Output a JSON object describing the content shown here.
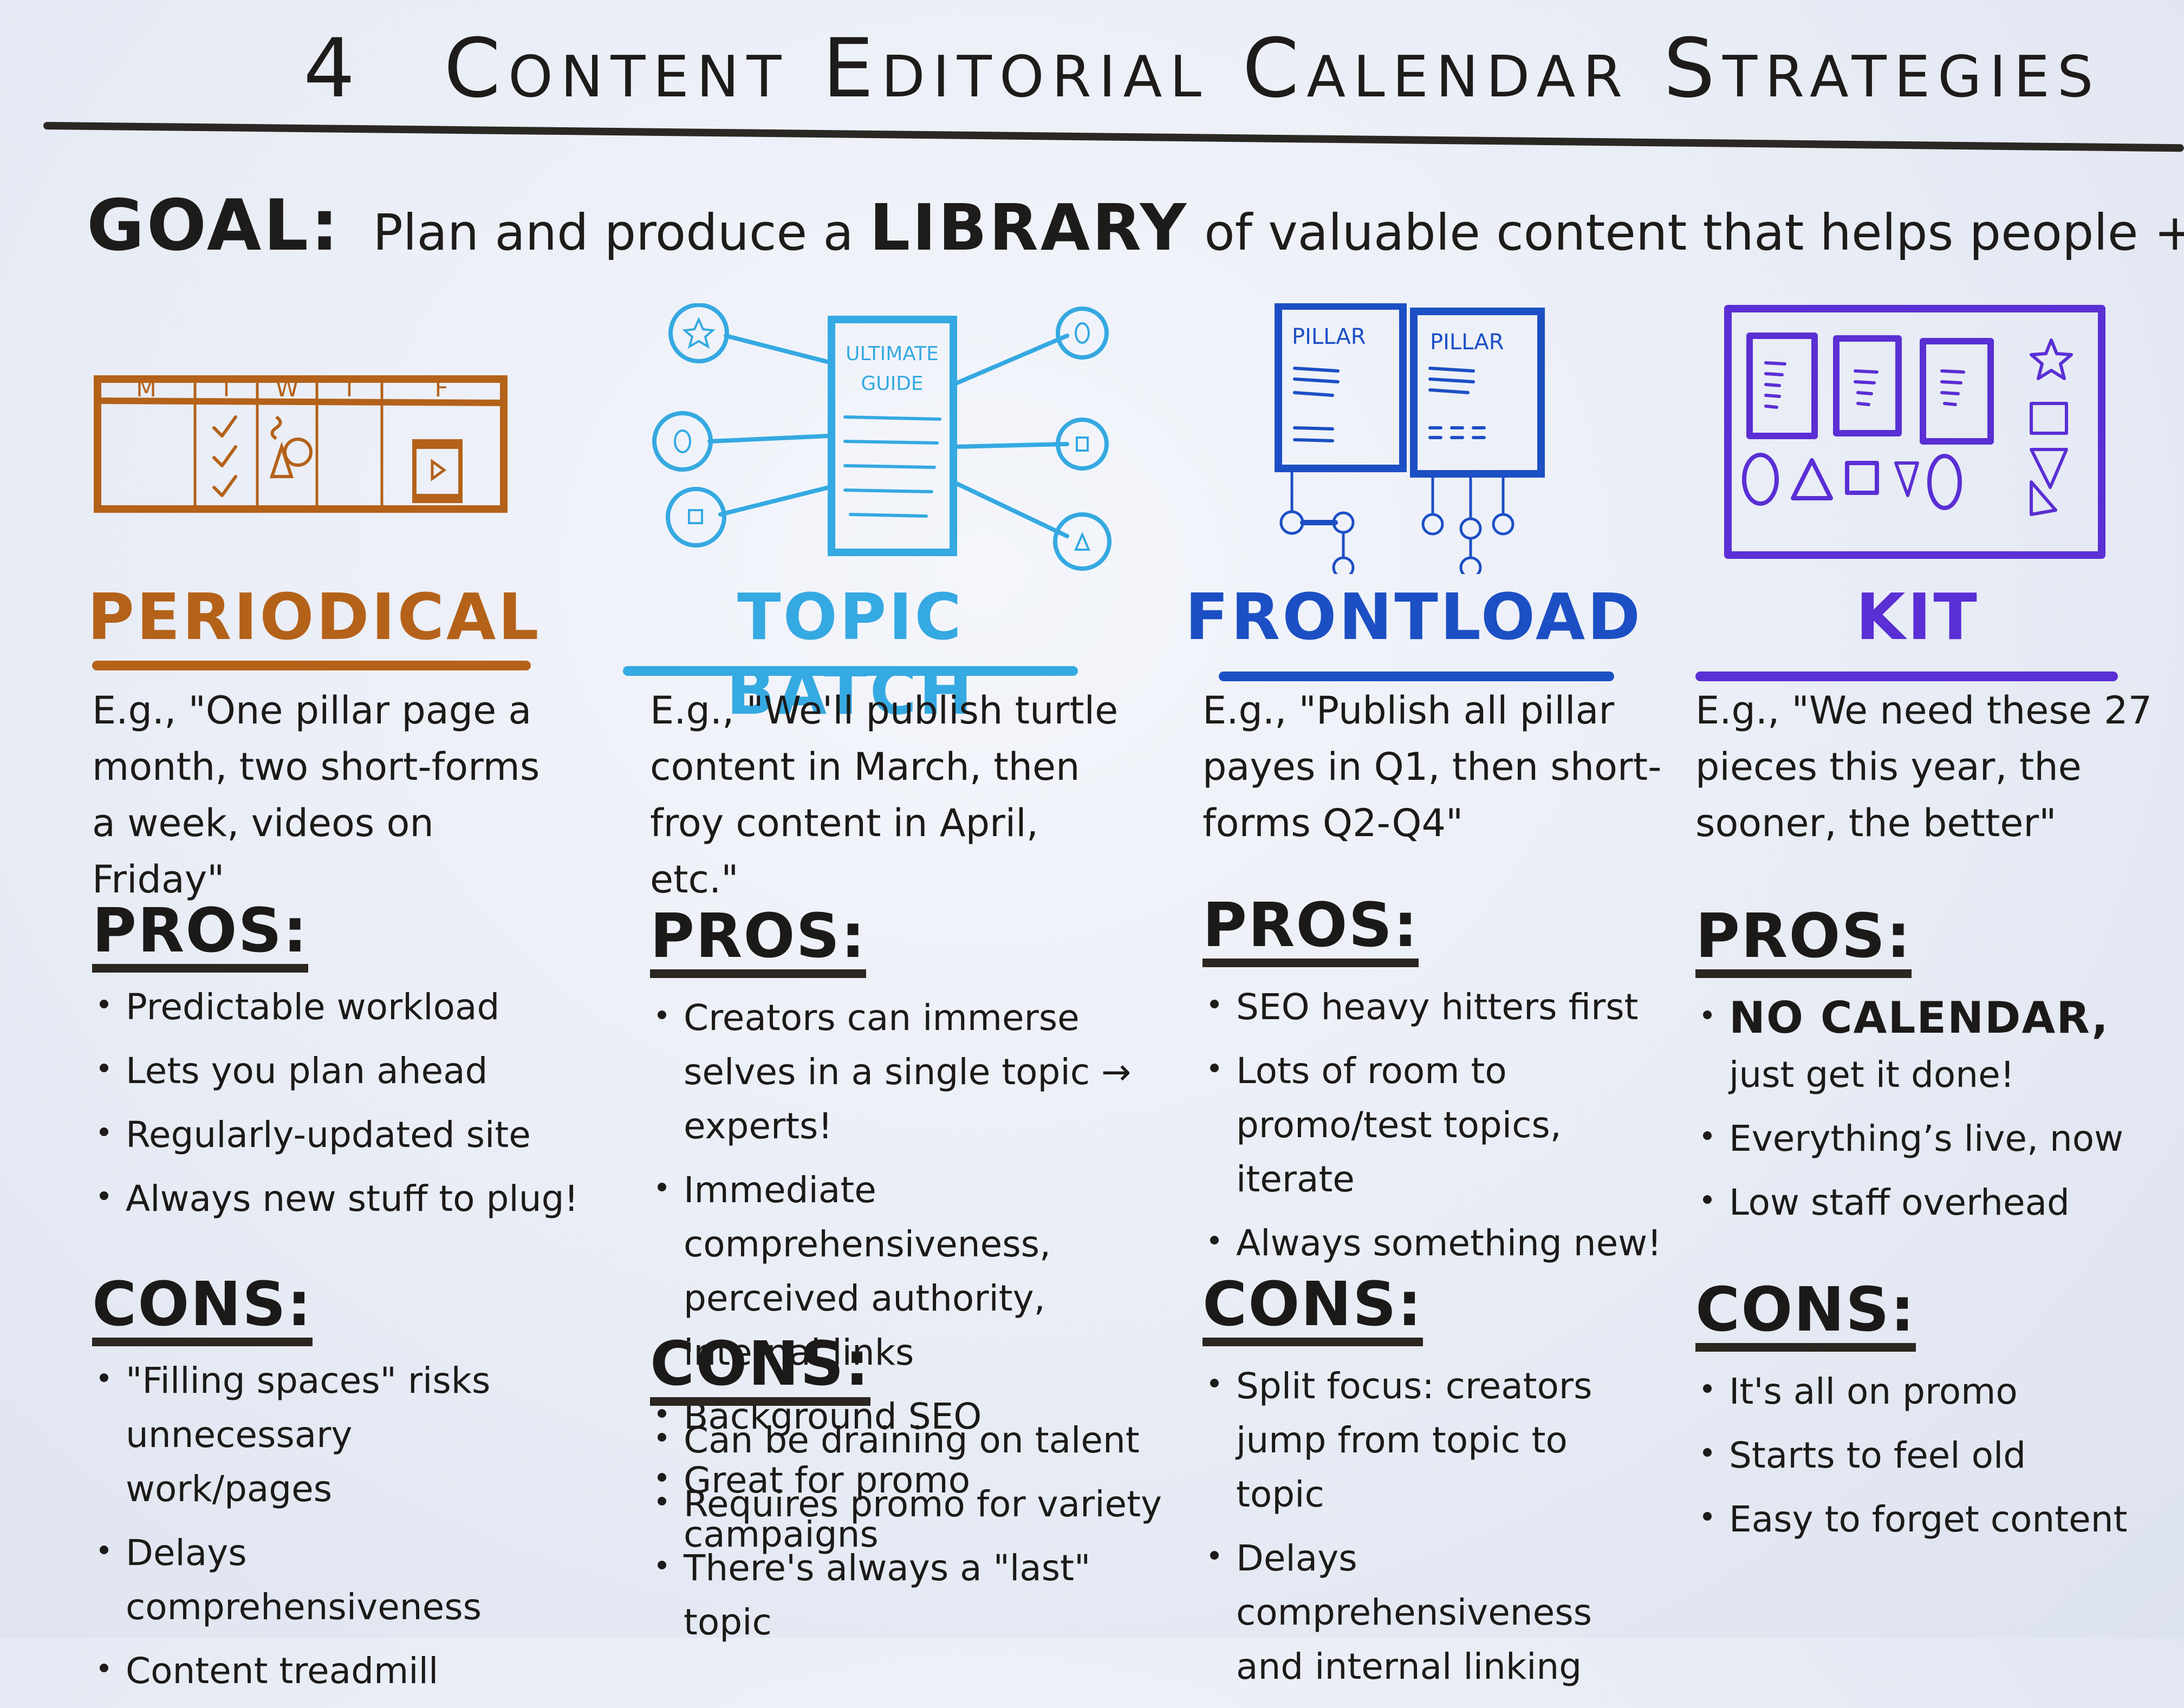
{
  "title": {
    "number": "4",
    "text": "Content Editorial Calendar Strategies"
  },
  "goal": {
    "label": "GOAL:",
    "text_before": "Plan and produce a",
    "emphasis": "LIBRARY",
    "text_after": "of valuable content that helps people + you."
  },
  "colors": {
    "periodical": "#b4621a",
    "topic_batch": "#35a9e1",
    "frontload": "#1c4fc4",
    "kit": "#5a2fd4",
    "ink": "#1e1c1a"
  },
  "strategies": [
    {
      "name": "PERIODICAL",
      "illustration": {
        "type": "weekly-calendar",
        "days": [
          "M",
          "T",
          "W",
          "T",
          "F"
        ],
        "icons": [
          "checkmarks",
          "mixed-shapes",
          "video-play"
        ]
      },
      "example": "E.g., \"One pillar page a month, two short-forms a week, videos on Friday\"",
      "pros_label": "PROS:",
      "pros": [
        "Predictable workload",
        "Lets you plan ahead",
        "Regularly-updated site",
        "Always new stuff to plug!"
      ],
      "cons_label": "CONS:",
      "cons": [
        "\"Filling spaces\" risks unnecessary work/pages",
        "Delays comprehensiveness",
        "Content treadmill"
      ]
    },
    {
      "name": "TOPIC BATCH",
      "illustration": {
        "type": "hub-and-spoke",
        "doc_label_1": "ULTIMATE",
        "doc_label_2": "GUIDE",
        "icons": [
          "star",
          "circle",
          "square",
          "circle",
          "square",
          "triangle"
        ]
      },
      "example": "E.g., \"We'll publish turtle content in March, then froy content in April, etc.\"",
      "pros_label": "PROS:",
      "pros": [
        "Creators can immerse selves in a single topic → experts!",
        "Immediate comprehensiveness, perceived authority, internal links",
        "Background SEO",
        "Great for promo campaigns"
      ],
      "cons_label": "CONS:",
      "cons": [
        "Can be draining on talent",
        "Requires promo for variety",
        "There's always a \"last\" topic"
      ]
    },
    {
      "name": "FRONTLOAD",
      "illustration": {
        "type": "pillar-pages",
        "doc_label": "PILLAR"
      },
      "example": "E.g., \"Publish all pillar payes in Q1, then short-forms Q2-Q4\"",
      "pros_label": "PROS:",
      "pros": [
        "SEO heavy hitters first",
        "Lots of room to promo/test topics, iterate",
        "Always something new!"
      ],
      "cons_label": "CONS:",
      "cons": [
        "Split focus: creators jump from topic to topic",
        "Delays comprehensiveness and internal linking"
      ]
    },
    {
      "name": "KIT",
      "illustration": {
        "type": "content-kit",
        "icons": [
          "star",
          "square",
          "triangle-down",
          "triangle",
          "circle",
          "triangle",
          "square",
          "triangle-down",
          "circle"
        ]
      },
      "example": "E.g., \"We need these 27 pieces this year, the sooner, the better\"",
      "pros_label": "PROS:",
      "pros_first_emphasis": "NO CALENDAR,",
      "pros_first_rest": "just get it done!",
      "pros": [
        "Everything’s live, now",
        "Low staff overhead"
      ],
      "cons_label": "CONS:",
      "cons": [
        "It's all on promo",
        "Starts to feel old",
        "Easy to forget content"
      ]
    }
  ]
}
